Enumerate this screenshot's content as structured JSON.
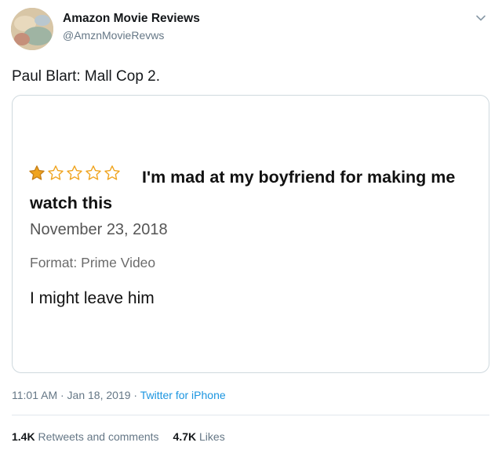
{
  "tweet": {
    "display_name": "Amazon Movie Reviews",
    "handle": "@AmznMovieRevws",
    "text": "Paul Blart: Mall Cop 2.",
    "timestamp": "11:01 AM · Jan 18, 2019 · ",
    "source": "Twitter for iPhone",
    "caret_icon": "chevron-down-icon"
  },
  "review": {
    "rating": 1,
    "max_rating": 5,
    "star_filled_color": "#f0a41f",
    "star_empty_color": "#f0a41f",
    "title": "I'm mad at my boyfriend for making me watch this",
    "date": "November 23, 2018",
    "format": "Format: Prime Video",
    "body": "I might leave him"
  },
  "stats": {
    "retweets_count": "1.4K",
    "retweets_label": " Retweets and comments",
    "likes_count": "4.7K",
    "likes_label": " Likes"
  },
  "colors": {
    "link": "#1b95e0",
    "secondary_text": "#657786"
  }
}
